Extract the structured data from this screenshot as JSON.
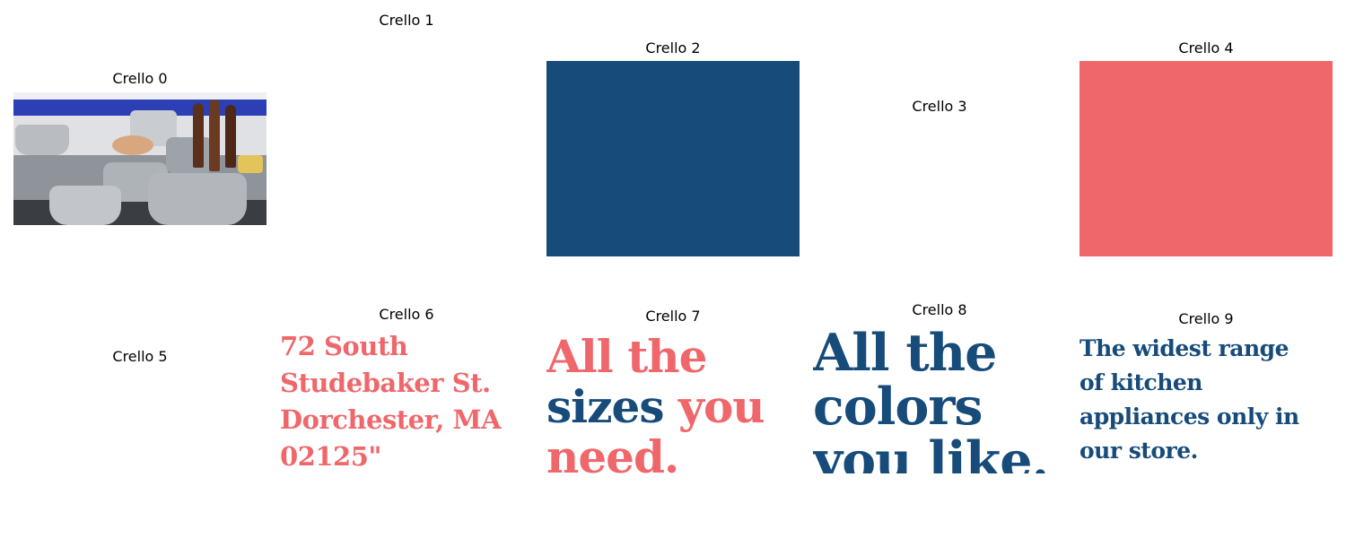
{
  "tiles": [
    {
      "label": "Crello 0",
      "kind": "photo",
      "image_icon": "cookware-photo"
    },
    {
      "label": "Crello 1",
      "kind": "empty"
    },
    {
      "label": "Crello 2",
      "kind": "color",
      "color": "#164b7a"
    },
    {
      "label": "Crello 3",
      "kind": "empty"
    },
    {
      "label": "Crello 4",
      "kind": "color",
      "color": "#ef676b"
    },
    {
      "label": "Crello 5",
      "kind": "empty"
    },
    {
      "label": "Crello 6",
      "kind": "text",
      "color": "#ef676b",
      "lines": [
        "72 South",
        "Studebaker St.",
        "Dorchester, MA",
        "02125\""
      ]
    },
    {
      "label": "Crello 7",
      "kind": "text",
      "lines": [
        [
          {
            "text": "All the",
            "color": "#ef676b"
          }
        ],
        [
          {
            "text": "sizes ",
            "color": "#164b7a"
          },
          {
            "text": "you",
            "color": "#ef676b"
          }
        ],
        [
          {
            "text": "need.",
            "color": "#ef676b"
          }
        ]
      ]
    },
    {
      "label": "Crello 8",
      "kind": "text",
      "color": "#164b7a",
      "lines": [
        "All the",
        "colors",
        "you like."
      ]
    },
    {
      "label": "Crello 9",
      "kind": "text",
      "color": "#164b7a",
      "lines": [
        "The widest range",
        "of kitchen",
        "appliances only in",
        "our store."
      ]
    }
  ]
}
